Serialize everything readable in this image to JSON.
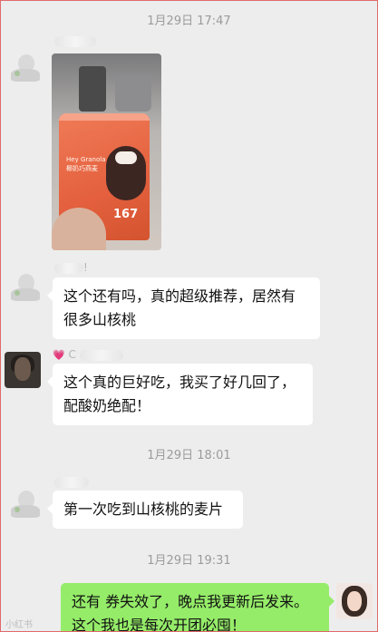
{
  "timestamps": [
    "1月29日 17:47",
    "1月29日 18:01",
    "1月29日 19:31"
  ],
  "messages": {
    "m1_name_suffix": "",
    "m2_name_suffix": "!",
    "m2_text_line1": "这个还有吗，真的超级推荐，居然有",
    "m2_text_line2": "很多山核桃",
    "m3_name_suffix": "C",
    "m3_text_line1": "这个真的巨好吃，我买了好几回了，",
    "m3_text_line2": "配酸奶绝配！",
    "m4_text": "第一次吃到山核桃的麦片",
    "m5_text_line1": "还有 券失效了，晚点我更新后发来。",
    "m5_text_line2": "这个我也是每次开团必囤！"
  },
  "photo": {
    "bag_logo": "",
    "bag_label": "Hey Granola",
    "bag_label_cn": "椰奶巧燕麦",
    "bag_number": "167"
  },
  "colors": {
    "self_bubble": "#95ec69",
    "other_bubble": "#ffffff",
    "background": "#ededed"
  },
  "watermark": "小红书"
}
